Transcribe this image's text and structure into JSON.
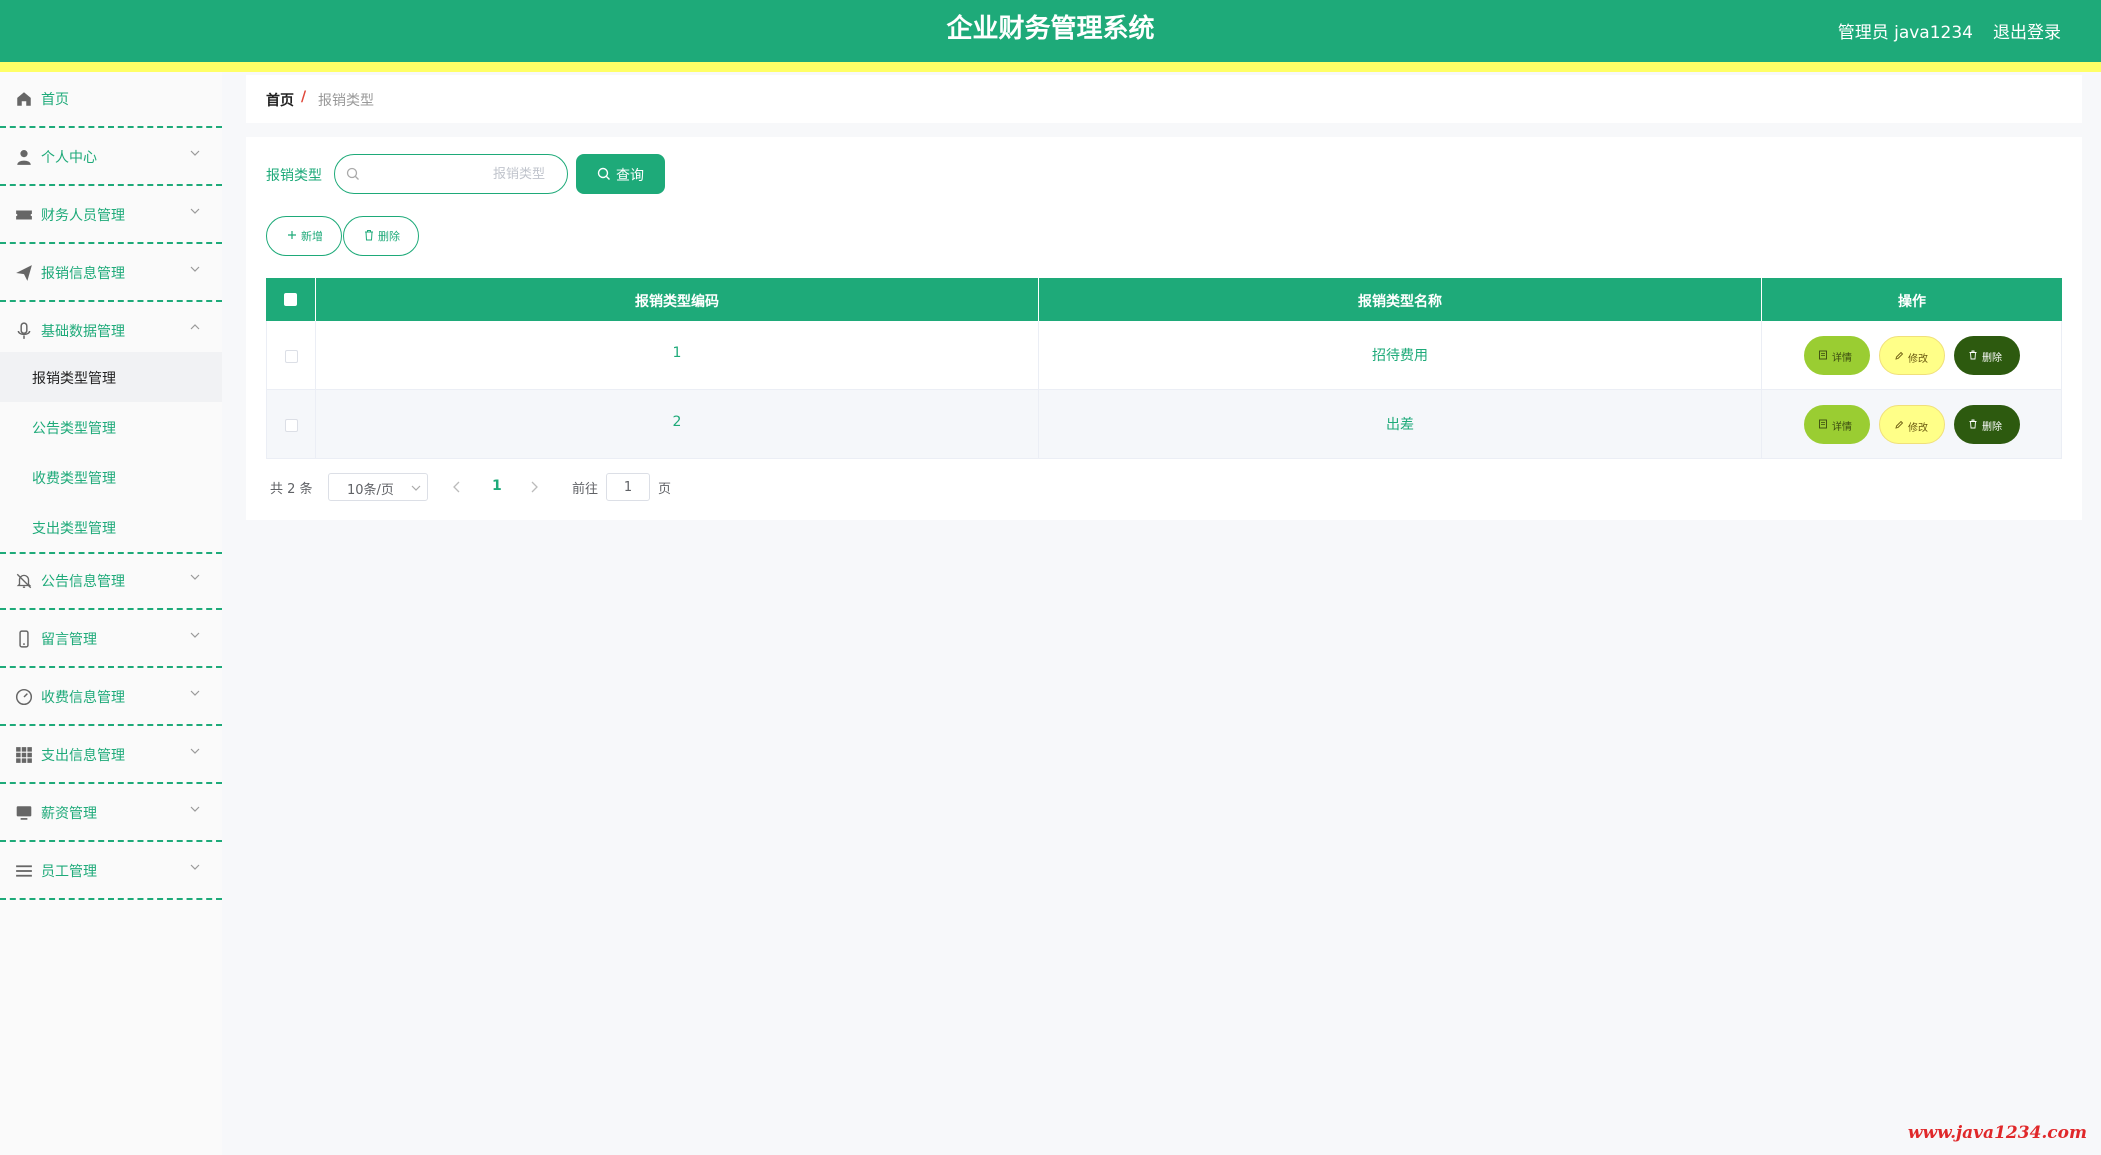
{
  "header": {
    "title": "企业财务管理系统",
    "user": "管理员 java1234",
    "logout": "退出登录"
  },
  "sidebar": {
    "items": [
      {
        "label": "首页",
        "icon": "home-icon"
      },
      {
        "label": "个人中心",
        "icon": "user-icon"
      },
      {
        "label": "财务人员管理",
        "icon": "ticket-icon"
      },
      {
        "label": "报销信息管理",
        "icon": "send-icon"
      },
      {
        "label": "基础数据管理",
        "icon": "microphone-icon",
        "expanded": true
      },
      {
        "label": "公告信息管理",
        "icon": "bell-off-icon"
      },
      {
        "label": "留言管理",
        "icon": "phone-icon"
      },
      {
        "label": "收费信息管理",
        "icon": "gauge-icon"
      },
      {
        "label": "支出信息管理",
        "icon": "grid-icon"
      },
      {
        "label": "薪资管理",
        "icon": "monitor-icon"
      },
      {
        "label": "员工管理",
        "icon": "list-icon"
      }
    ],
    "subitems": [
      {
        "label": "报销类型管理",
        "active": true
      },
      {
        "label": "公告类型管理"
      },
      {
        "label": "收费类型管理"
      },
      {
        "label": "支出类型管理"
      }
    ]
  },
  "breadcrumb": {
    "home": "首页",
    "separator": "/",
    "current": "报销类型"
  },
  "search": {
    "label": "报销类型",
    "placeholder": "报销类型",
    "value": "",
    "button": "查询"
  },
  "actions": {
    "add": "新增",
    "delete": "删除"
  },
  "table": {
    "columns": [
      "报销类型编码",
      "报销类型名称",
      "操作"
    ],
    "rows": [
      {
        "code": "1",
        "name": "招待费用"
      },
      {
        "code": "2",
        "name": "出差"
      }
    ],
    "row_actions": {
      "detail": "详情",
      "edit": "修改",
      "delete": "删除"
    }
  },
  "pagination": {
    "total": "共 2 条",
    "page_size": "10条/页",
    "current_page": "1",
    "goto_label": "前往",
    "goto_value": "1",
    "goto_suffix": "页"
  },
  "watermark": "www.java1234.com",
  "colors": {
    "primary": "#1eaa79",
    "accent_stripe": "#ffff66",
    "detail_button": "#9acd32",
    "edit_button": "#ffff88",
    "delete_button": "#2d5a0f"
  }
}
